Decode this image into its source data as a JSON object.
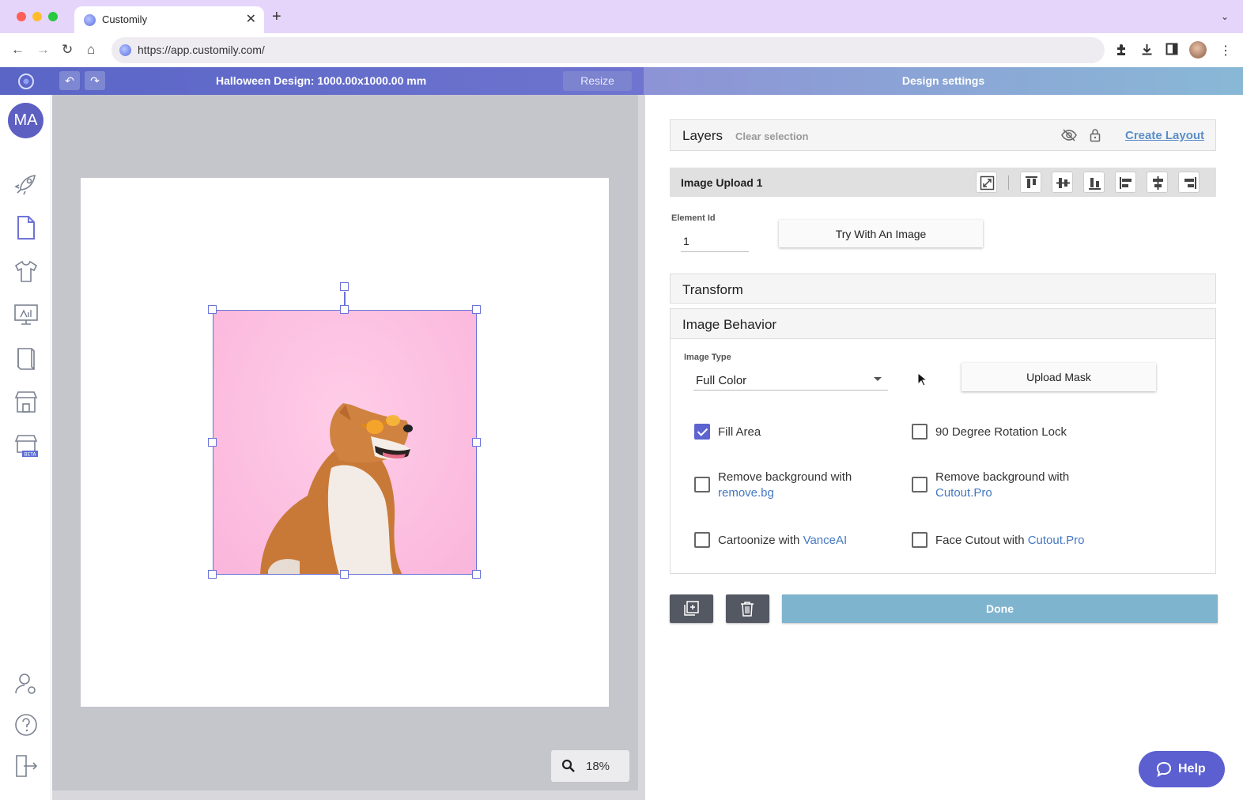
{
  "browser": {
    "tab_title": "Customily",
    "url": "https://app.customily.com/"
  },
  "header": {
    "design_title": "Halloween Design: 1000.00x1000.00 mm",
    "resize_label": "Resize",
    "settings_title": "Design settings"
  },
  "sidebar": {
    "avatar_initials": "MA",
    "items": [
      "rocket-icon",
      "document-icon",
      "tshirt-icon",
      "monitor-icon",
      "book-icon",
      "store-icon",
      "store-beta-icon"
    ],
    "bottom_items": [
      "user-settings-icon",
      "help-circle-icon",
      "logout-icon"
    ]
  },
  "canvas": {
    "zoom_level": "18%"
  },
  "layers": {
    "title": "Layers",
    "clear_selection": "Clear selection",
    "create_layout": "Create Layout"
  },
  "element": {
    "title": "Image Upload 1",
    "id_label": "Element Id",
    "id_value": "1",
    "try_button": "Try With An Image"
  },
  "transform": {
    "title": "Transform"
  },
  "behavior": {
    "title": "Image Behavior",
    "image_type_label": "Image Type",
    "image_type_value": "Full Color",
    "upload_mask": "Upload Mask",
    "options": {
      "fill_area": {
        "label": "Fill Area",
        "checked": true
      },
      "rotation_lock": {
        "label": "90 Degree Rotation Lock",
        "checked": false
      },
      "removebg": {
        "label": "Remove background with",
        "link": "remove.bg",
        "checked": false
      },
      "cutout_bg": {
        "label": "Remove background with",
        "link": "Cutout.Pro",
        "checked": false
      },
      "cartoonize": {
        "label": "Cartoonize with ",
        "link": "VanceAI",
        "checked": false
      },
      "face_cutout": {
        "label": "Face Cutout with ",
        "link": "Cutout.Pro",
        "checked": false
      }
    }
  },
  "actions": {
    "done": "Done",
    "help": "Help"
  }
}
